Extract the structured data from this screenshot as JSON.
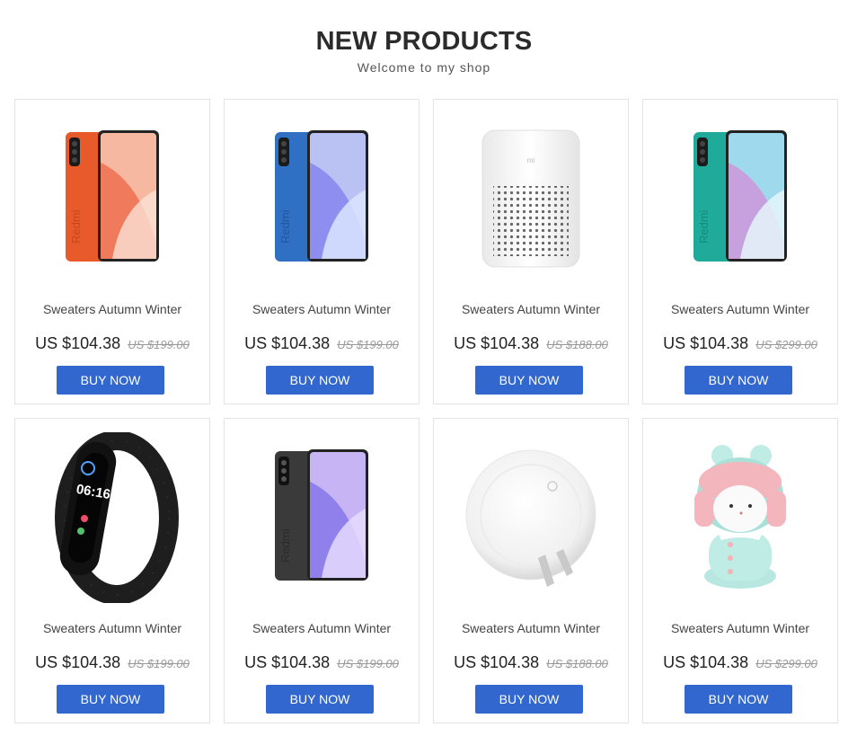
{
  "header": {
    "title": "NEW PRODUCTS",
    "subtitle": "Welcome to my shop"
  },
  "products": [
    {
      "name": "Sweaters Autumn Winter",
      "price": "US $104.38",
      "old_price": "US $199.00",
      "button": "BUY NOW",
      "image": "phone-orange"
    },
    {
      "name": "Sweaters Autumn Winter",
      "price": "US $104.38",
      "old_price": "US $199.00",
      "button": "BUY NOW",
      "image": "phone-blue"
    },
    {
      "name": "Sweaters Autumn Winter",
      "price": "US $104.38",
      "old_price": "US $188.00",
      "button": "BUY NOW",
      "image": "smart-speaker"
    },
    {
      "name": "Sweaters Autumn Winter",
      "price": "US $104.38",
      "old_price": "US $299.00",
      "button": "BUY NOW",
      "image": "phone-green"
    },
    {
      "name": "Sweaters Autumn Winter",
      "price": "US $104.38",
      "old_price": "US $199.00",
      "button": "BUY NOW",
      "image": "fitness-band"
    },
    {
      "name": "Sweaters Autumn Winter",
      "price": "US $104.38",
      "old_price": "US $199.00",
      "button": "BUY NOW",
      "image": "phone-gray"
    },
    {
      "name": "Sweaters Autumn Winter",
      "price": "US $104.38",
      "old_price": "US $188.00",
      "button": "BUY NOW",
      "image": "night-light"
    },
    {
      "name": "Sweaters Autumn Winter",
      "price": "US $104.38",
      "old_price": "US $299.00",
      "button": "BUY NOW",
      "image": "mitu-figure"
    }
  ],
  "colors": {
    "button": "#3267d0",
    "phone_orange": "#e85a2a",
    "phone_blue": "#2f6fc4",
    "phone_green": "#1faa9a",
    "phone_gray": "#3a3a3a"
  }
}
